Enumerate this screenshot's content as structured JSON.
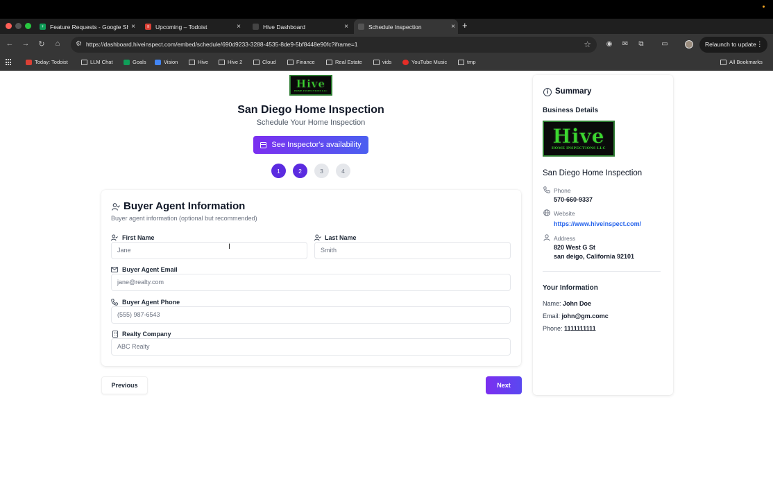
{
  "browser": {
    "tabs": [
      {
        "title": "Feature Requests - Google Sh",
        "favicon_color": "#0f9d58",
        "active": false
      },
      {
        "title": "Upcoming – Todoist",
        "favicon_color": "#db4035",
        "active": false
      },
      {
        "title": "Hive Dashboard",
        "favicon_color": "#444444",
        "active": false
      },
      {
        "title": "Schedule Inspection",
        "favicon_color": "#555555",
        "active": true
      }
    ],
    "url": "https://dashboard.hiveinspect.com/embed/schedule/690d9233-3288-4535-8de9-5bf8448e90fc?iframe=1",
    "relaunch_label": "Relaunch to update",
    "bookmarks": [
      {
        "label": "Today: Todoist",
        "icon": "todoist-icon",
        "color": "#db4035"
      },
      {
        "label": "LLM Chat",
        "icon": "folder-icon"
      },
      {
        "label": "Goals",
        "icon": "sheets-icon",
        "color": "#0f9d58"
      },
      {
        "label": "Vision",
        "icon": "docs-icon",
        "color": "#4285f4"
      },
      {
        "label": "Hive",
        "icon": "folder-icon"
      },
      {
        "label": "Hive 2",
        "icon": "folder-icon"
      },
      {
        "label": "Cloud",
        "icon": "folder-icon"
      },
      {
        "label": "Finance",
        "icon": "folder-icon"
      },
      {
        "label": "Real Estate",
        "icon": "folder-icon"
      },
      {
        "label": "vids",
        "icon": "folder-icon"
      },
      {
        "label": "YouTube Music",
        "icon": "youtube-music-icon",
        "color": "#e52d27"
      },
      {
        "label": "tmp",
        "icon": "folder-icon"
      }
    ],
    "all_bookmarks": "All Bookmarks"
  },
  "header": {
    "logo_text": "Hive",
    "logo_subtext": "HOME INSPECTIONS LLC",
    "business_name": "San Diego Home Inspection",
    "subtitle": "Schedule Your Home Inspection",
    "availability_button": "See Inspector's availability"
  },
  "steps": [
    {
      "label": "1",
      "state": "done"
    },
    {
      "label": "2",
      "state": "current"
    },
    {
      "label": "3",
      "state": "upcoming"
    },
    {
      "label": "4",
      "state": "upcoming"
    }
  ],
  "form": {
    "title": "Buyer Agent Information",
    "subtitle": "Buyer agent information (optional but recommended)",
    "first_name": {
      "label": "First Name",
      "placeholder": "Jane"
    },
    "last_name": {
      "label": "Last Name",
      "placeholder": "Smith"
    },
    "email": {
      "label": "Buyer Agent Email",
      "placeholder": "jane@realty.com"
    },
    "phone": {
      "label": "Buyer Agent Phone",
      "placeholder": "(555) 987-6543"
    },
    "company": {
      "label": "Realty Company",
      "placeholder": "ABC Realty"
    }
  },
  "nav": {
    "previous": "Previous",
    "next": "Next"
  },
  "summary": {
    "title": "Summary",
    "business_details": "Business Details",
    "business_name": "San Diego Home Inspection",
    "phone_label": "Phone",
    "phone": "570-660-9337",
    "website_label": "Website",
    "website": "https://www.hiveinspect.com/",
    "address_label": "Address",
    "address_line1": "820 West G St",
    "address_line2": "san deigo, California 92101",
    "your_info": "Your Information",
    "name_label": "Name:",
    "name": "John Doe",
    "email_label": "Email:",
    "email": "john@gm.comc",
    "phone2_label": "Phone:",
    "phone2": "1111111111"
  },
  "colors": {
    "accent": "#5b2be0",
    "brand_green": "#3bd62f",
    "link": "#2563eb"
  }
}
